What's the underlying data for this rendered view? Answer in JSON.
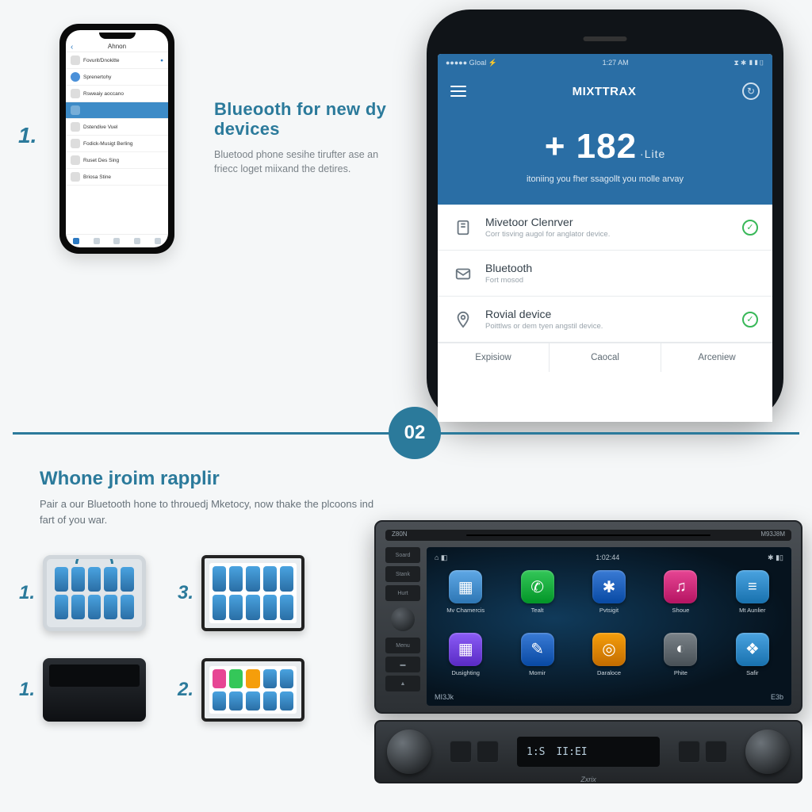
{
  "smallPhone": {
    "header": "Ahnon",
    "rows": [
      {
        "label": "Fovurit/Dnokitte"
      },
      {
        "label": "Sprenertohy"
      },
      {
        "label": "Rsweaiy aoccano"
      },
      {
        "label": ""
      },
      {
        "label": "Dstendive Vuel"
      },
      {
        "label": "Fodick-Musigt Berling"
      },
      {
        "label": "Ruset Des Sing"
      },
      {
        "label": "Briosa Stine"
      }
    ]
  },
  "step1": {
    "num": "1.",
    "heading": "Blueooth for new dy devices",
    "body": "Bluetood phone sesihe tirufter ase an friecc loget miixand the detires."
  },
  "bigPhone": {
    "status": {
      "left": "●●●●● GIoal ⚡",
      "center": "1:27 AM",
      "right": "⧗ ✱ ▮▮▯"
    },
    "appTitle": "MIXTTRAX",
    "hero": {
      "num": "+ 182",
      "unit": "·Lite",
      "sub": "itoniing you fher ssagollt you molle arvay"
    },
    "items": [
      {
        "title": "Mivetoor Clenrver",
        "sub": "Corr tisving augol for anglator device.",
        "icon": "device-icon"
      },
      {
        "title": "Bluetooth",
        "sub": "Fort mosod",
        "icon": "mail-icon"
      },
      {
        "title": "Rovial device",
        "sub": "Poittlws or dem tyen angstil device.",
        "icon": "pin-icon"
      }
    ],
    "buttons": [
      "Expisiow",
      "Caocal",
      "Arceniew"
    ]
  },
  "badge": "02",
  "section2": {
    "heading": "Whone jroim rapplir",
    "body": "Pair a our Bluetooth hone to throuedj Mketocy, now thake the plcoons ind fart of you war."
  },
  "thumbs": [
    {
      "n": "1."
    },
    {
      "n": "3."
    },
    {
      "n": "1."
    },
    {
      "n": "2."
    }
  ],
  "unit": {
    "slot": {
      "left": "Z80N",
      "right": "M93J8M"
    },
    "sideButtons": [
      "Soard",
      "Stank",
      "Hurt",
      "Menu"
    ],
    "clock": "1:02:44",
    "apps": [
      {
        "label": "Mv Chamercis",
        "color": "#5fa8e6",
        "glyph": "calendar-icon"
      },
      {
        "label": "Tealt",
        "color": "#34c759",
        "glyph": "phone-icon"
      },
      {
        "label": "Pvtsigit",
        "color": "#3a7bd5",
        "glyph": "bluetooth-icon"
      },
      {
        "label": "Shoue",
        "color": "#e74694",
        "glyph": "music-icon"
      },
      {
        "label": "Mt Aunlier",
        "color": "#4aa3e0",
        "glyph": "equalizer-icon"
      },
      {
        "label": "Dusighting",
        "color": "#8b5cf6",
        "glyph": "grid-icon"
      },
      {
        "label": "Momir",
        "color": "#3a7bd5",
        "glyph": "wrench-icon"
      },
      {
        "label": "Daraloce",
        "color": "#f59e0b",
        "glyph": "target-icon"
      },
      {
        "label": "Phite",
        "color": "#7a8288",
        "glyph": "gauge-icon"
      },
      {
        "label": "Safir",
        "color": "#4aa3e0",
        "glyph": "runner-icon"
      }
    ],
    "botbar": {
      "left": "MI3Jk",
      "right": "E3b"
    },
    "display": {
      "a": "1:S",
      "b": "II:EI"
    },
    "brand": "Zxrix"
  }
}
